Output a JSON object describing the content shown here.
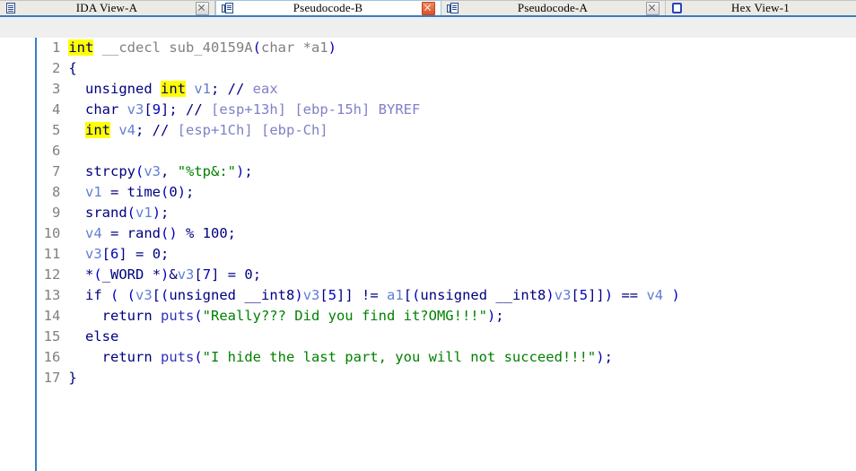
{
  "window": {
    "app": "IDA",
    "view": "Pseudocode-B"
  },
  "tabbar": {
    "tabs": [
      {
        "label": "IDA View-A",
        "icon": "document-icon",
        "active": false,
        "closable": true,
        "close_hot": false
      },
      {
        "label": "Pseudocode-B",
        "icon": "pseudocode-icon",
        "active": true,
        "closable": true,
        "close_hot": true
      },
      {
        "label": "Pseudocode-A",
        "icon": "pseudocode-icon",
        "active": false,
        "closable": true,
        "close_hot": false
      },
      {
        "label": "Hex View-1",
        "icon": "hex-view-icon",
        "active": false,
        "closable": true,
        "close_hot": false
      }
    ]
  },
  "colors": {
    "accent_blue": "#3a7ebf",
    "keyword": "#000080",
    "variable": "#5f7fd4",
    "string": "#008000",
    "number": "#0000c0",
    "comment_text": "#8080c8",
    "function_gray": "#808080",
    "highlight_bg": "#ffff00",
    "current_line_bg": "#efefef"
  },
  "code": {
    "language": "c-pseudocode",
    "highlighted_token": "int",
    "current_line": 1,
    "line_count": 17,
    "lines": [
      {
        "n": "1",
        "text": "int __cdecl sub_40159A(char *a1)"
      },
      {
        "n": "2",
        "text": "{"
      },
      {
        "n": "3",
        "text": "  unsigned int v1; // eax"
      },
      {
        "n": "4",
        "text": "  char v3[9]; // [esp+13h] [ebp-15h] BYREF"
      },
      {
        "n": "5",
        "text": "  int v4; // [esp+1Ch] [ebp-Ch]"
      },
      {
        "n": "6",
        "text": ""
      },
      {
        "n": "7",
        "text": "  strcpy(v3, \"%tp&:\");"
      },
      {
        "n": "8",
        "text": "  v1 = time(0);"
      },
      {
        "n": "9",
        "text": "  srand(v1);"
      },
      {
        "n": "10",
        "text": "  v4 = rand() % 100;"
      },
      {
        "n": "11",
        "text": "  v3[6] = 0;"
      },
      {
        "n": "12",
        "text": "  *(_WORD *)&v3[7] = 0;"
      },
      {
        "n": "13",
        "text": "  if ( (v3[(unsigned __int8)v3[5]] != a1[(unsigned __int8)v3[5]]) == v4 )"
      },
      {
        "n": "14",
        "text": "    return puts(\"Really??? Did you find it?OMG!!!\");"
      },
      {
        "n": "15",
        "text": "  else"
      },
      {
        "n": "16",
        "text": "    return puts(\"I hide the last part, you will not succeed!!!\");"
      },
      {
        "n": "17",
        "text": "}"
      }
    ],
    "strings": [
      "%tp&:",
      "Really??? Did you find it?OMG!!!",
      "I hide the last part, you will not succeed!!!"
    ],
    "comments": [
      "// eax",
      "// [esp+13h] [ebp-15h] BYREF",
      "// [esp+1Ch] [ebp-Ch]"
    ],
    "function_name": "sub_40159A",
    "calling_convention": "__cdecl",
    "return_type": "int",
    "parameter": "char *a1"
  },
  "linenos": [
    "1",
    "2",
    "3",
    "4",
    "5",
    "6",
    "7",
    "8",
    "9",
    "10",
    "11",
    "12",
    "13",
    "14",
    "15",
    "16",
    "17"
  ]
}
